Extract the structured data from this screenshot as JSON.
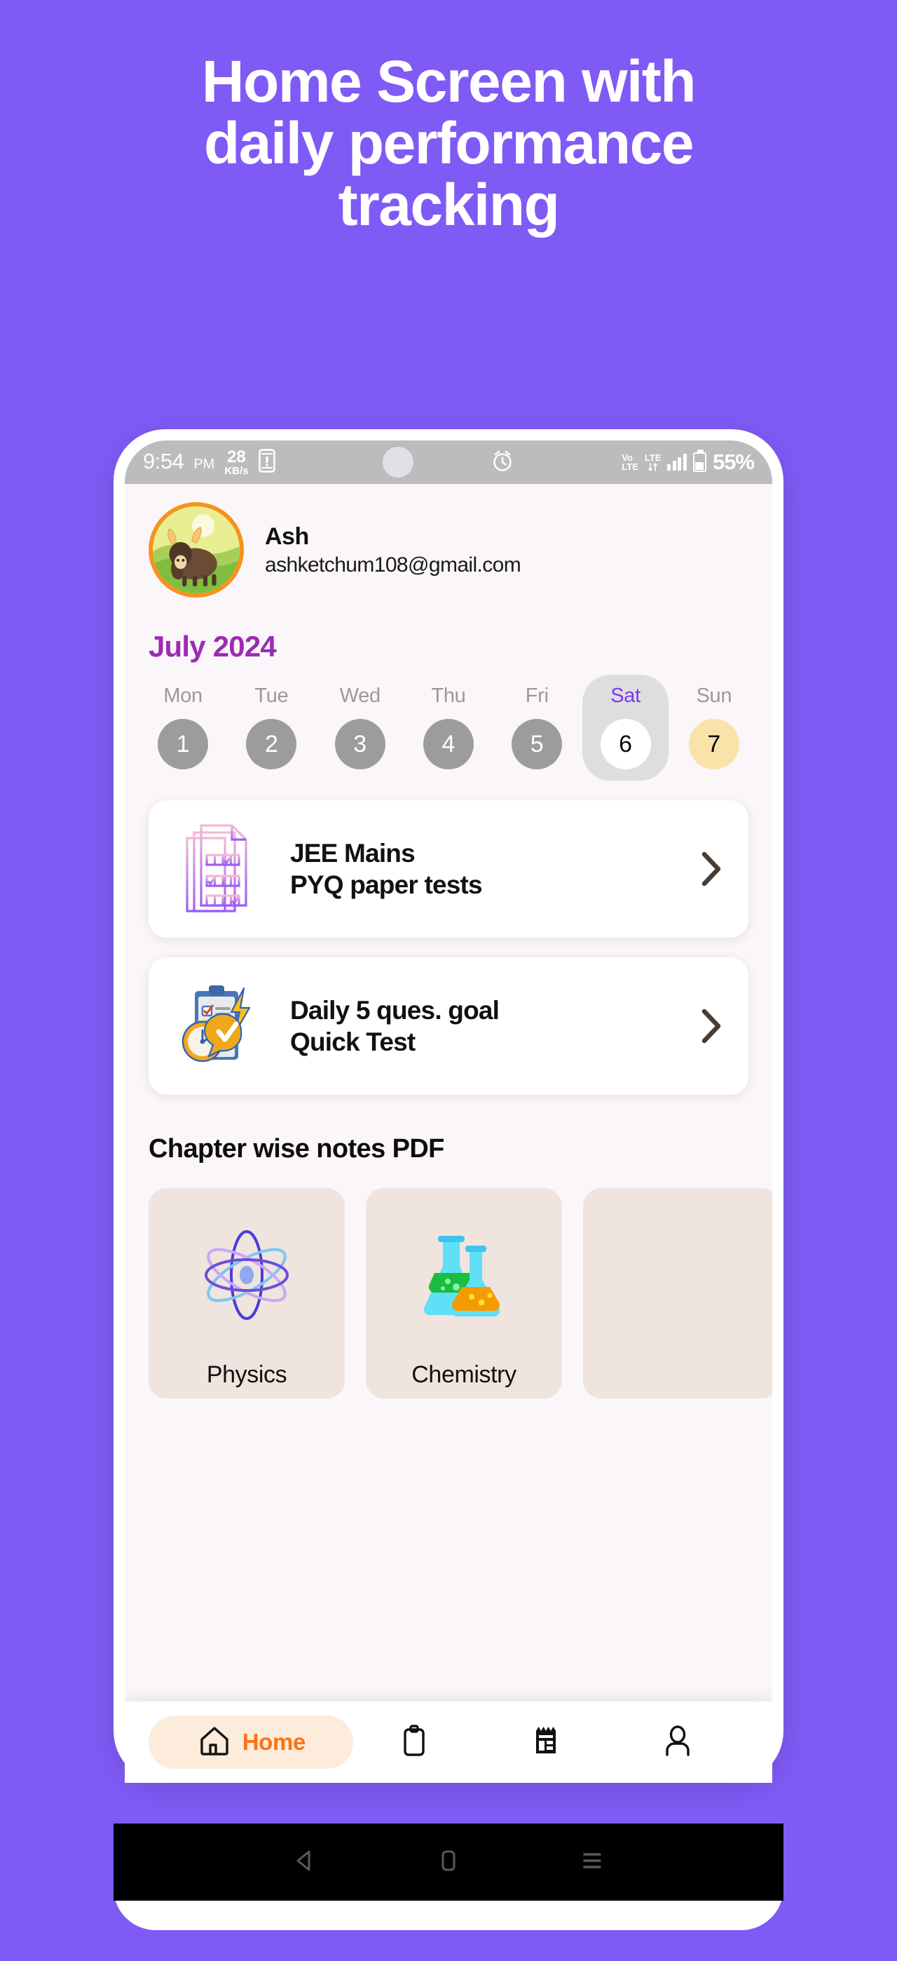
{
  "promo": {
    "line1": "Home Screen with",
    "line2": "daily performance",
    "line3": "tracking",
    "bg_color": "#7F5AF5"
  },
  "status_bar": {
    "time": "9:54",
    "ampm": "PM",
    "data_rate_value": "28",
    "data_rate_unit": "KB/s",
    "sim_icon": "phone-alert-icon",
    "alarm_icon": "alarm-clock-icon",
    "volte_line1": "Vo",
    "volte_line2": "LTE",
    "network_line1": "LTE",
    "network_icon": "lte-data-arrows-icon",
    "signal_icon": "signal-bars-icon",
    "battery_percent": "55%"
  },
  "profile": {
    "name": "Ash",
    "email": "ashketchum108@gmail.com",
    "avatar_alt": "yak-avatar",
    "ring_color": "#F6921E"
  },
  "calendar": {
    "title": "July 2024",
    "title_color": "#9B2BB5",
    "selected_color": "#7C3AED",
    "days": [
      {
        "dow": "Mon",
        "date": "1",
        "state": "past"
      },
      {
        "dow": "Tue",
        "date": "2",
        "state": "past"
      },
      {
        "dow": "Wed",
        "date": "3",
        "state": "past"
      },
      {
        "dow": "Thu",
        "date": "4",
        "state": "past"
      },
      {
        "dow": "Fri",
        "date": "5",
        "state": "past"
      },
      {
        "dow": "Sat",
        "date": "6",
        "state": "selected"
      },
      {
        "dow": "Sun",
        "date": "7",
        "state": "weekend"
      }
    ]
  },
  "cards": [
    {
      "line1": "JEE Mains",
      "line2": "PYQ paper tests",
      "icon": "paper-stack-checklist-icon",
      "chevron": "chevron-right-icon"
    },
    {
      "line1": "Daily 5 ques. goal",
      "line2": "Quick Test",
      "icon": "clipboard-stopwatch-check-icon",
      "chevron": "chevron-right-icon"
    }
  ],
  "notes_section": {
    "title": "Chapter wise notes PDF",
    "cards": [
      {
        "label": "Physics",
        "icon": "atom-icon"
      },
      {
        "label": "Chemistry",
        "icon": "flasks-icon"
      },
      {
        "label": "",
        "icon": ""
      }
    ]
  },
  "bottom_nav": {
    "items": [
      {
        "label": "Home",
        "icon": "home-icon",
        "active": true
      },
      {
        "label": "",
        "icon": "clipboard-icon",
        "active": false
      },
      {
        "label": "",
        "icon": "notes-calendar-icon",
        "active": false
      },
      {
        "label": "",
        "icon": "person-icon",
        "active": false
      }
    ],
    "active_color": "#F97316",
    "active_pill_bg": "#FDEBDB"
  },
  "android_nav": {
    "back": "back-triangle-icon",
    "home": "home-square-icon",
    "recents": "recents-lines-icon"
  }
}
